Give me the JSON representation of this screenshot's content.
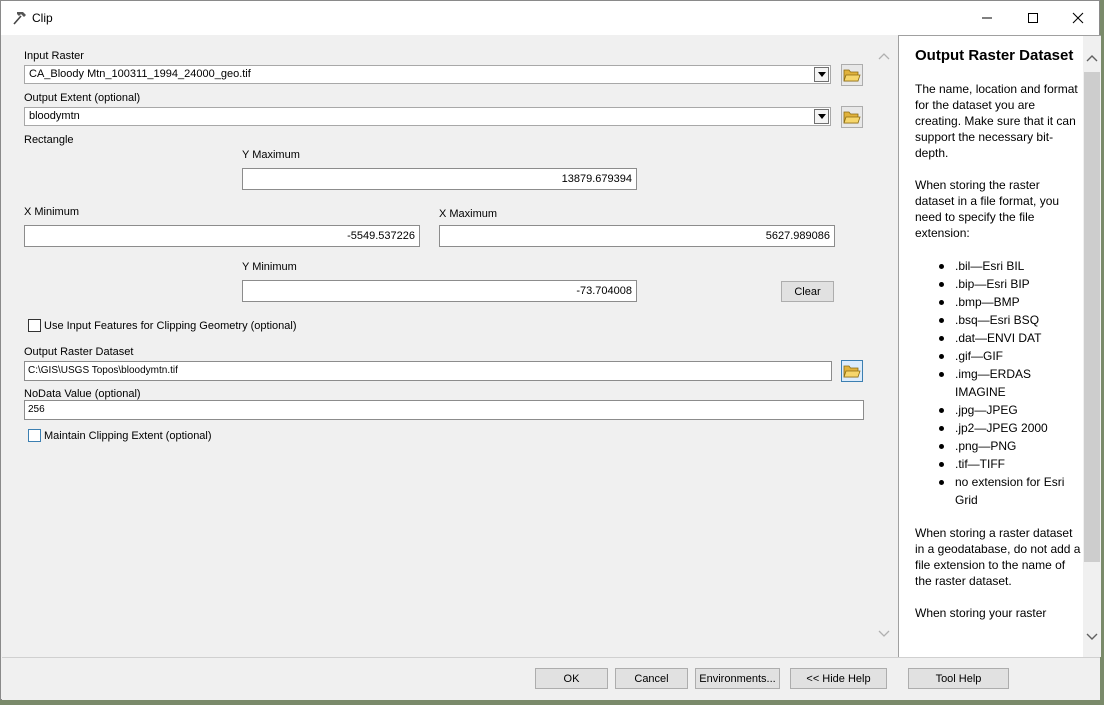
{
  "window": {
    "title": "Clip"
  },
  "form": {
    "input_raster": {
      "label": "Input Raster",
      "value": "CA_Bloody Mtn_100311_1994_24000_geo.tif"
    },
    "output_extent": {
      "label": "Output Extent (optional)",
      "value": "bloodymtn"
    },
    "rectangle_label": "Rectangle",
    "y_maximum": {
      "label": "Y Maximum",
      "value": "13879.679394"
    },
    "x_minimum": {
      "label": "X Minimum",
      "value": "-5549.537226"
    },
    "x_maximum": {
      "label": "X Maximum",
      "value": "5627.989086"
    },
    "y_minimum": {
      "label": "Y Minimum",
      "value": "-73.704008"
    },
    "clear_label": "Clear",
    "use_input_features": {
      "label": "Use Input Features for Clipping Geometry (optional)",
      "checked": false
    },
    "output_raster_dataset": {
      "label": "Output Raster Dataset",
      "value": "C:\\GIS\\USGS Topos\\bloodymtn.tif"
    },
    "nodata_value": {
      "label": "NoData Value (optional)",
      "value": "256"
    },
    "maintain_clipping_extent": {
      "label": "Maintain Clipping Extent (optional)",
      "checked": false
    }
  },
  "help": {
    "title": "Output Raster Dataset",
    "para1": "The name, location and format for the dataset you are creating. Make sure that it can support the necessary bit-depth.",
    "para2": "When storing the raster dataset in a file format, you need to specify the file extension:",
    "extensions": [
      ".bil—Esri BIL",
      ".bip—Esri BIP",
      ".bmp—BMP",
      ".bsq—Esri BSQ",
      ".dat—ENVI DAT",
      ".gif—GIF",
      ".img—ERDAS IMAGINE",
      ".jpg—JPEG",
      ".jp2—JPEG 2000",
      ".png—PNG",
      ".tif—TIFF",
      "no extension for Esri Grid"
    ],
    "para3": "When storing a raster dataset in a geodatabase, do not add a file extension to the name of the raster dataset.",
    "para4": "When storing your raster"
  },
  "buttons": {
    "ok": "OK",
    "cancel": "Cancel",
    "environments": "Environments...",
    "hide_help": "<< Hide Help",
    "tool_help": "Tool Help"
  },
  "icons": {
    "app": "hammer-icon",
    "browse": "folder-open-icon"
  }
}
